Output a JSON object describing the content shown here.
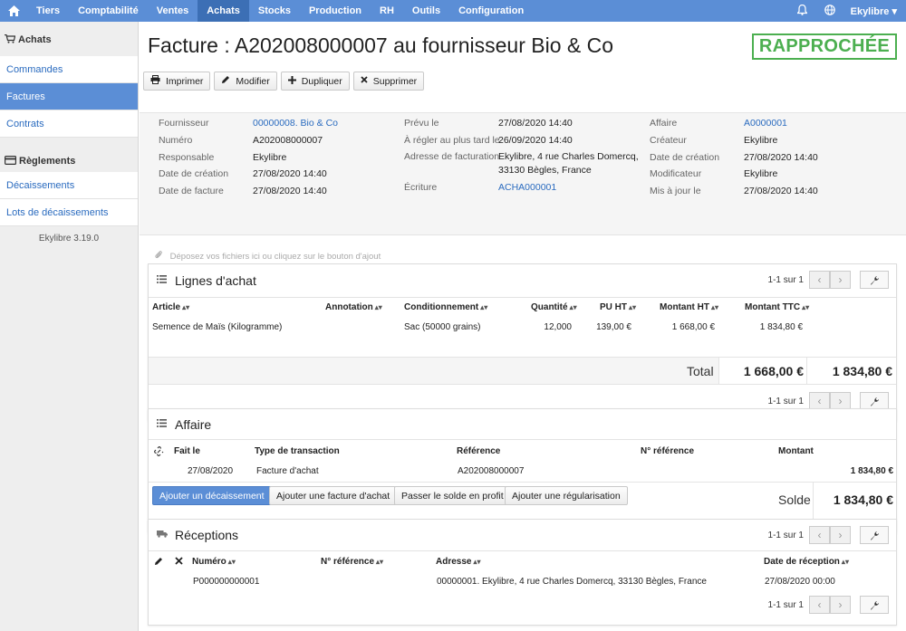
{
  "nav": {
    "items": [
      "Tiers",
      "Comptabilité",
      "Ventes",
      "Achats",
      "Stocks",
      "Production",
      "RH",
      "Outils",
      "Configuration"
    ],
    "active": "Achats",
    "user": "Ekylibre ▾"
  },
  "sidebar": {
    "section1": "Achats",
    "items1": [
      "Commandes",
      "Factures",
      "Contrats"
    ],
    "section2": "Règlements",
    "items2": [
      "Décaissements",
      "Lots de décaissements"
    ],
    "version": "Ekylibre 3.19.0"
  },
  "page": {
    "title": "Facture : A202008000007 au fournisseur Bio & Co",
    "status": "RAPPROCHÉE"
  },
  "toolbar": {
    "print": "Imprimer",
    "edit": "Modifier",
    "duplicate": "Dupliquer",
    "delete": "Supprimer"
  },
  "fields": {
    "fournisseur_l": "Fournisseur",
    "fournisseur_v": "00000008. Bio & Co",
    "numero_l": "Numéro",
    "numero_v": "A202008000007",
    "responsable_l": "Responsable",
    "responsable_v": "Ekylibre",
    "creation_l": "Date de création",
    "creation_v": "27/08/2020 14:40",
    "facture_l": "Date de facture",
    "facture_v": "27/08/2020 14:40",
    "prevu_l": "Prévu le",
    "prevu_v": "27/08/2020 14:40",
    "regler_l": "À régler au plus tard le",
    "regler_v": "26/09/2020 14:40",
    "adresse_l": "Adresse de facturation",
    "adresse_v1": "Ekylibre, 4 rue Charles Domercq,",
    "adresse_v2": "33130 Bègles, France",
    "ecriture_l": "Écriture",
    "ecriture_v": "ACHA000001",
    "affaire_l": "Affaire",
    "affaire_v": "A0000001",
    "createur_l": "Créateur",
    "createur_v": "Ekylibre",
    "creation2_l": "Date de création",
    "creation2_v": "27/08/2020 14:40",
    "modif_l": "Modificateur",
    "modif_v": "Ekylibre",
    "maj_l": "Mis à jour le",
    "maj_v": "27/08/2020 14:40"
  },
  "dropzone": "Déposez vos fichiers ici ou cliquez sur le bouton d'ajout",
  "lines": {
    "title": "Lignes d'achat",
    "count": "1-1 sur 1",
    "headers": [
      "Article",
      "Annotation",
      "Conditionnement",
      "Quantité",
      "PU HT",
      "Montant HT",
      "Montant TTC"
    ],
    "row": [
      "Semence de Maïs (Kilogramme)",
      "",
      "Sac (50000 grains)",
      "12,000",
      "139,00 €",
      "1 668,00 €",
      "1 834,80 €"
    ],
    "total_label": "Total",
    "total_ht": "1 668,00 €",
    "total_ttc": "1 834,80 €"
  },
  "affaire": {
    "title": "Affaire",
    "headers": [
      "Fait le",
      "Type de transaction",
      "Référence",
      "N° référence",
      "Montant"
    ],
    "row": [
      "27/08/2020",
      "Facture d'achat",
      "A202008000007",
      "",
      "1 834,80 €"
    ],
    "btn_decaissement": "Ajouter un décaissement",
    "btn_facture": "Ajouter une facture d'achat",
    "btn_solde": "Passer le solde en profit",
    "btn_regul": "Ajouter une régularisation",
    "solde_label": "Solde",
    "solde_value": "1 834,80 €"
  },
  "receptions": {
    "title": "Réceptions",
    "count": "1-1 sur 1",
    "headers": [
      "Numéro",
      "N° référence",
      "Adresse",
      "Date de réception"
    ],
    "row": [
      "P000000000001",
      "",
      "00000001. Ekylibre, 4 rue Charles Domercq, 33130 Bègles, France",
      "27/08/2020 00:00"
    ]
  },
  "colors": {
    "nav": "#5b8ed6",
    "active": "#3c6fb5",
    "link": "#2a6bbf",
    "status": "#4caf50"
  }
}
